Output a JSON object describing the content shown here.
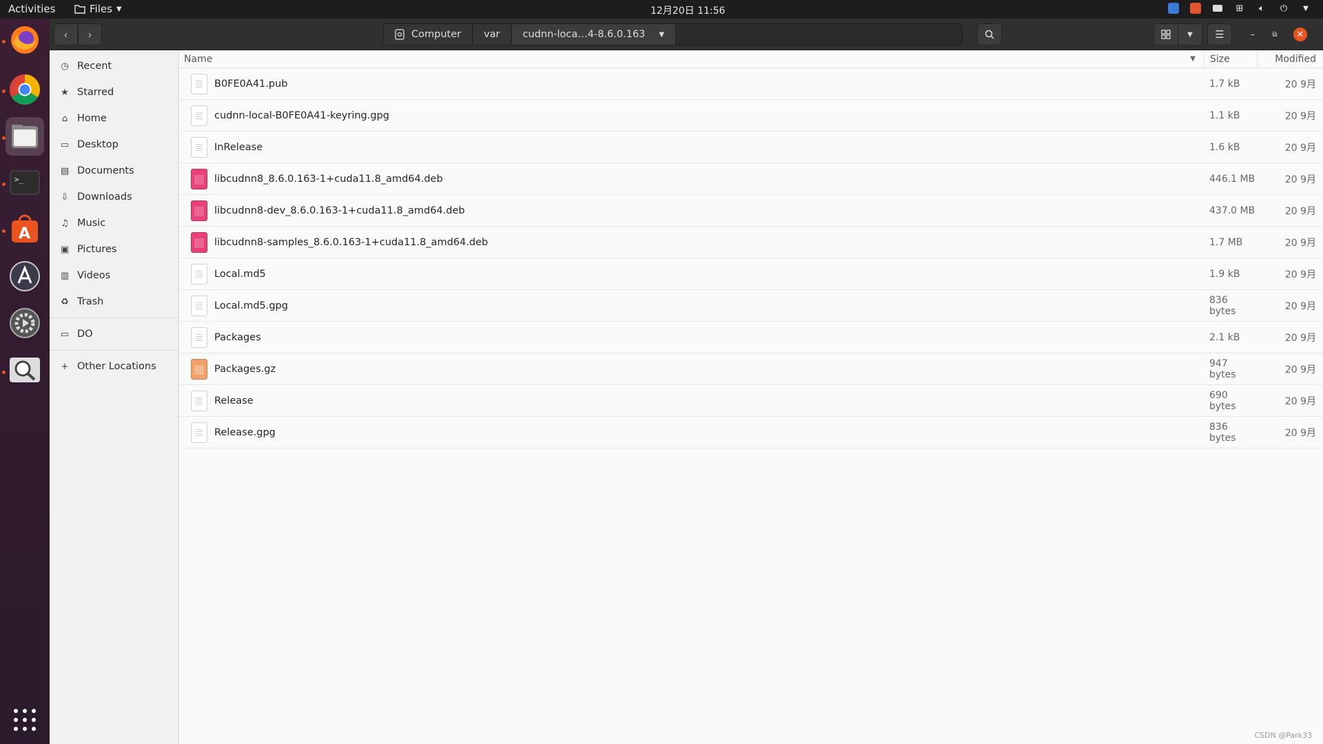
{
  "topbar": {
    "activities": "Activities",
    "app_menu": "Files",
    "clock": "12月20日  11:56"
  },
  "dock": {
    "items": [
      "firefox-icon",
      "chrome-icon",
      "files-icon",
      "terminal-icon",
      "software-icon",
      "app-store-icon",
      "settings-icon",
      "search-icon"
    ]
  },
  "header": {
    "path": [
      {
        "label": "Computer"
      },
      {
        "label": "var"
      },
      {
        "label": "cudnn-loca…4-8.6.0.163"
      }
    ]
  },
  "sidebar": {
    "items": [
      {
        "label": "Recent",
        "icon": "clock"
      },
      {
        "label": "Starred",
        "icon": "star"
      },
      {
        "label": "Home",
        "icon": "home"
      },
      {
        "label": "Desktop",
        "icon": "desktop"
      },
      {
        "label": "Documents",
        "icon": "documents"
      },
      {
        "label": "Downloads",
        "icon": "download"
      },
      {
        "label": "Music",
        "icon": "music"
      },
      {
        "label": "Pictures",
        "icon": "pictures"
      },
      {
        "label": "Videos",
        "icon": "videos"
      },
      {
        "label": "Trash",
        "icon": "trash"
      }
    ],
    "bookmarks": [
      {
        "label": "DO",
        "icon": "folder"
      }
    ],
    "other": {
      "label": "Other Locations"
    }
  },
  "columns": {
    "name": "Name",
    "size": "Size",
    "modified": "Modified"
  },
  "files": [
    {
      "name": "B0FE0A41.pub",
      "size": "1.7 kB",
      "modified": "20 9月",
      "type": "text"
    },
    {
      "name": "cudnn-local-B0FE0A41-keyring.gpg",
      "size": "1.1 kB",
      "modified": "20 9月",
      "type": "text"
    },
    {
      "name": "InRelease",
      "size": "1.6 kB",
      "modified": "20 9月",
      "type": "text"
    },
    {
      "name": "libcudnn8_8.6.0.163-1+cuda11.8_amd64.deb",
      "size": "446.1 MB",
      "modified": "20 9月",
      "type": "deb"
    },
    {
      "name": "libcudnn8-dev_8.6.0.163-1+cuda11.8_amd64.deb",
      "size": "437.0 MB",
      "modified": "20 9月",
      "type": "deb"
    },
    {
      "name": "libcudnn8-samples_8.6.0.163-1+cuda11.8_amd64.deb",
      "size": "1.7 MB",
      "modified": "20 9月",
      "type": "deb"
    },
    {
      "name": "Local.md5",
      "size": "1.9 kB",
      "modified": "20 9月",
      "type": "text"
    },
    {
      "name": "Local.md5.gpg",
      "size": "836 bytes",
      "modified": "20 9月",
      "type": "text"
    },
    {
      "name": "Packages",
      "size": "2.1 kB",
      "modified": "20 9月",
      "type": "text"
    },
    {
      "name": "Packages.gz",
      "size": "947 bytes",
      "modified": "20 9月",
      "type": "gz"
    },
    {
      "name": "Release",
      "size": "690 bytes",
      "modified": "20 9月",
      "type": "text"
    },
    {
      "name": "Release.gpg",
      "size": "836 bytes",
      "modified": "20 9月",
      "type": "text"
    }
  ],
  "watermark": "CSDN @Park33"
}
